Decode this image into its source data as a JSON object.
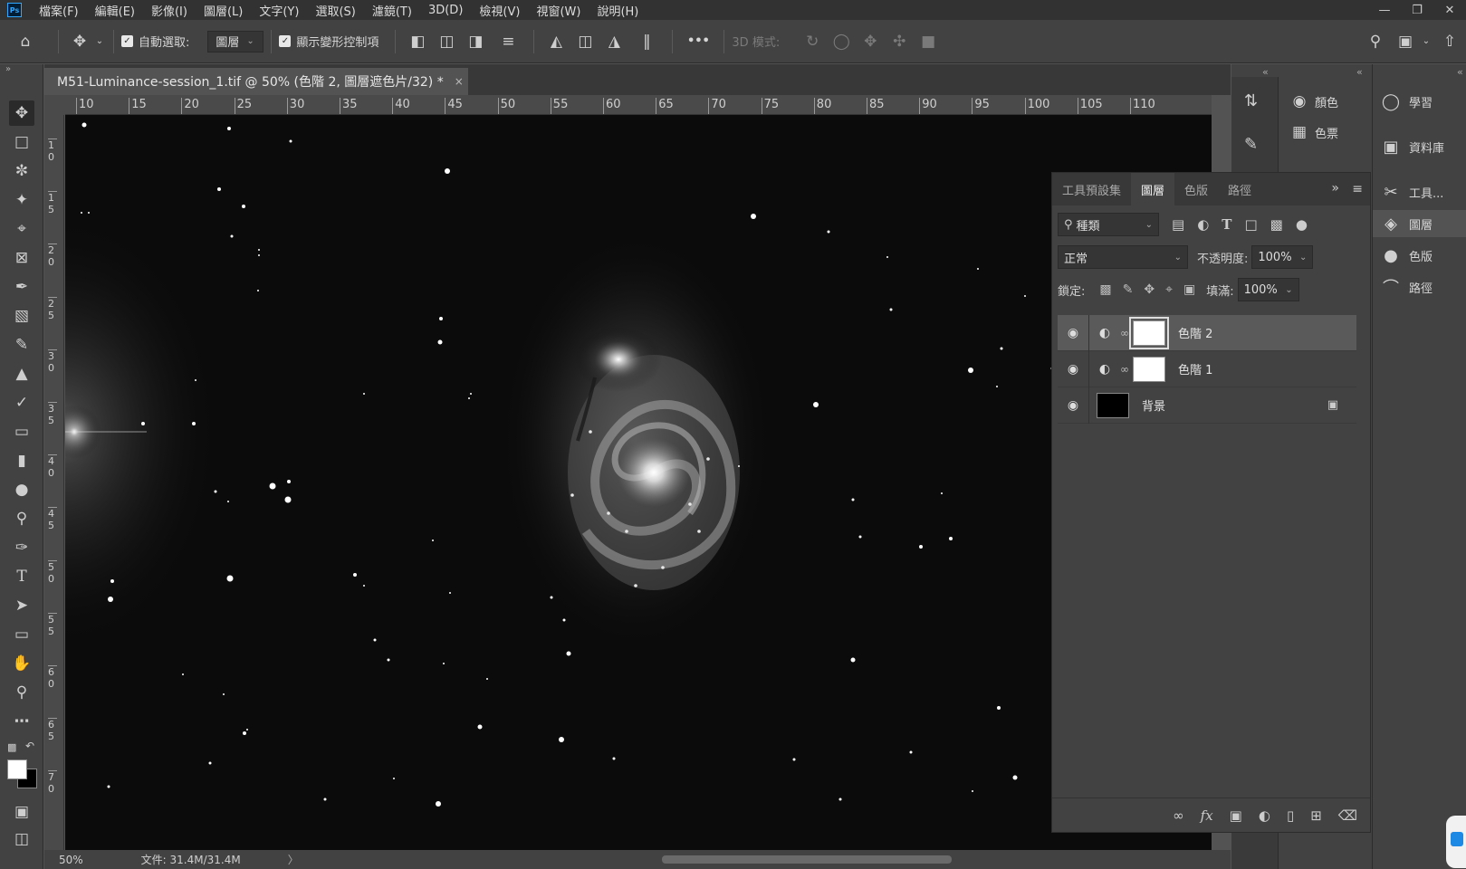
{
  "menubar": {
    "logo": "Ps",
    "items": [
      "檔案(F)",
      "編輯(E)",
      "影像(I)",
      "圖層(L)",
      "文字(Y)",
      "選取(S)",
      "濾鏡(T)",
      "3D(D)",
      "檢視(V)",
      "視窗(W)",
      "說明(H)"
    ],
    "window_controls": [
      "minimize-icon",
      "restore-icon",
      "close-icon"
    ]
  },
  "options_bar": {
    "auto_select_label": "自動選取:",
    "auto_select_target": "圖層",
    "show_transform_label": "顯示變形控制項",
    "more": "•••",
    "mode_3d_label": "3D 模式:"
  },
  "document": {
    "tab_title": "M51-Luminance-session_1.tif @ 50% (色階 2, 圖層遮色片/32) *",
    "close": "×"
  },
  "ruler": {
    "h_ticks": [
      "10",
      "15",
      "20",
      "25",
      "30",
      "35",
      "40",
      "45",
      "50",
      "55",
      "60",
      "65",
      "70",
      "75",
      "80",
      "85",
      "90",
      "95",
      "100",
      "105",
      "110"
    ],
    "v_ticks": [
      "1 0",
      "1 5",
      "2 0",
      "2 5",
      "3 0",
      "3 5",
      "4 0",
      "4 5",
      "5 0",
      "5 5",
      "6 0",
      "6 5",
      "7 0"
    ]
  },
  "status": {
    "zoom": "50%",
    "doc_info": "文件: 31.4M/31.4M",
    "arrow": "〉"
  },
  "mid_panel": {
    "items": [
      {
        "icon": "color-palette-icon",
        "label": "顏色"
      },
      {
        "icon": "swatches-grid-icon",
        "label": "色票"
      }
    ]
  },
  "right_panel": {
    "items": [
      {
        "icon": "lightbulb-icon",
        "label": "學習"
      },
      {
        "icon": "library-icon",
        "label": "資料庫"
      },
      {
        "icon": "tools-icon",
        "label": "工具..."
      },
      {
        "icon": "layers-icon",
        "label": "圖層"
      },
      {
        "icon": "channels-icon",
        "label": "色版"
      },
      {
        "icon": "paths-icon",
        "label": "路徑"
      }
    ]
  },
  "layers_panel": {
    "tabs": [
      "工具預設集",
      "圖層",
      "色版",
      "路徑"
    ],
    "active_tab": "圖層",
    "filter_kind": "種類",
    "blend_mode": "正常",
    "opacity_label": "不透明度:",
    "opacity_value": "100%",
    "lock_label": "鎖定:",
    "fill_label": "填滿:",
    "fill_value": "100%",
    "layers": [
      {
        "name": "色階 2",
        "type": "adjustment",
        "selected": true,
        "visible": true
      },
      {
        "name": "色階 1",
        "type": "adjustment",
        "selected": false,
        "visible": true
      },
      {
        "name": "背景",
        "type": "background",
        "selected": false,
        "visible": true,
        "locked": true
      }
    ]
  },
  "colors": {
    "accent": "#31a8ff",
    "panel_bg": "#424242",
    "canvas_bg": "#0b0b0b"
  }
}
